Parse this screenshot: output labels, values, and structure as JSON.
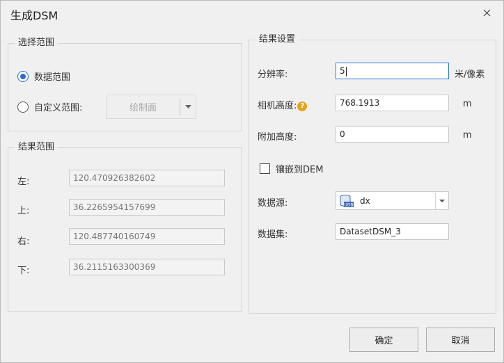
{
  "window": {
    "title": "生成DSM"
  },
  "select_range": {
    "title": "选择范围",
    "options": [
      {
        "label": "数据范围",
        "checked": true
      },
      {
        "label": "自定义范围:",
        "checked": false
      }
    ],
    "draw_surface": "绘制面"
  },
  "result_range": {
    "title": "结果范围",
    "left": {
      "label": "左:",
      "value": "120.470926382602"
    },
    "top": {
      "label": "上:",
      "value": "36.2265954157699"
    },
    "right": {
      "label": "右:",
      "value": "120.487740160749"
    },
    "bottom": {
      "label": "下:",
      "value": "36.2115163300369"
    }
  },
  "result_settings": {
    "title": "结果设置",
    "resolution": {
      "label": "分辨率:",
      "value": "5",
      "unit": "米/像素"
    },
    "camera_height": {
      "label": "相机高度:",
      "value": "768.1913",
      "unit": "m",
      "icon": "help-icon"
    },
    "additional_height": {
      "label": "附加高度:",
      "value": "0",
      "unit": "m"
    },
    "embed_dem": {
      "label": "镶嵌到DEM",
      "checked": false
    },
    "datasource": {
      "label": "数据源:",
      "value": "dx",
      "icon": "udb-datasource-icon"
    },
    "dataset": {
      "label": "数据集:",
      "value": "DatasetDSM_3"
    }
  },
  "buttons": {
    "ok": "确定",
    "cancel": "取消"
  }
}
